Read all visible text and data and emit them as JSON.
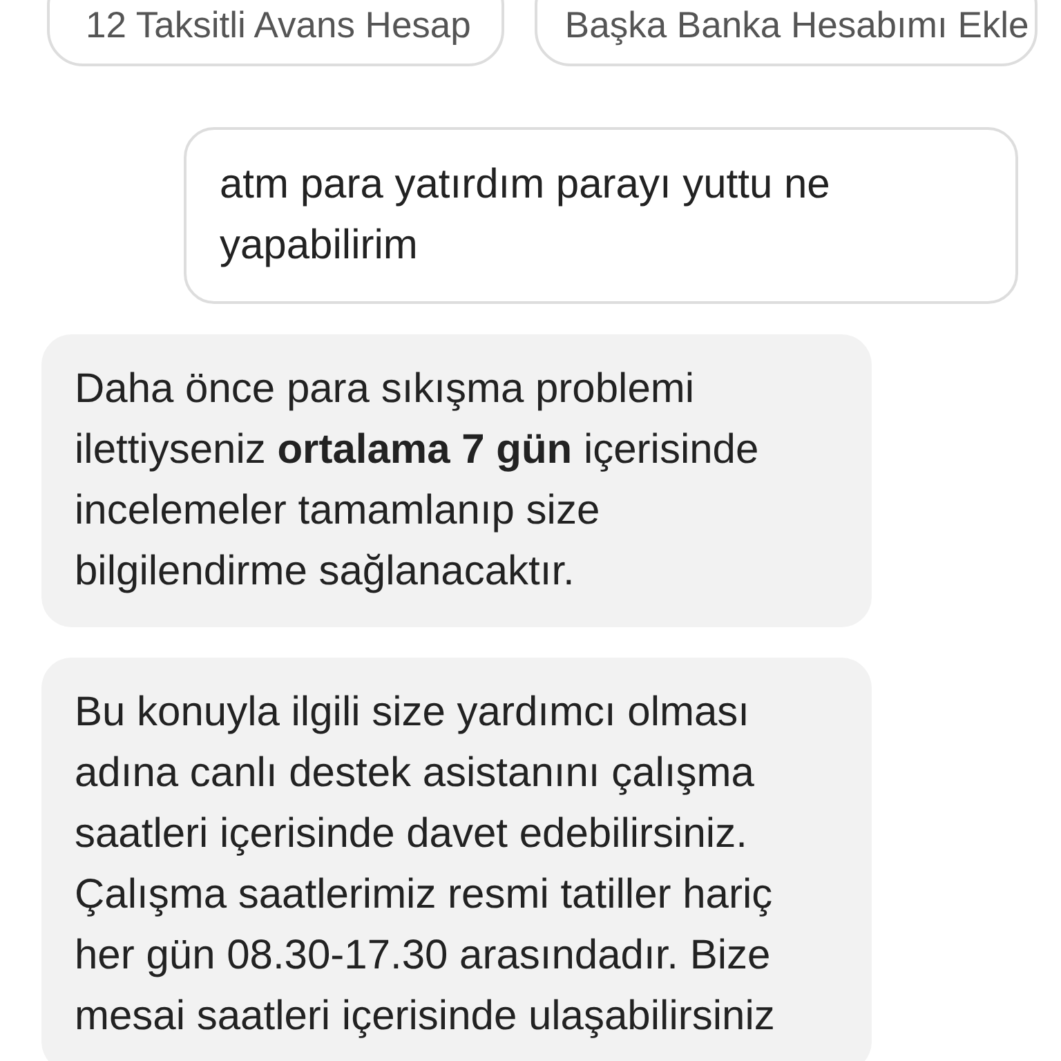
{
  "suggestions": [
    {
      "label": "12 Taksitli Avans Hesap"
    },
    {
      "label": "Başka Banka Hesabımı Ekle"
    }
  ],
  "messages": [
    {
      "kind": "user",
      "text": "atm para yatırdım parayı yuttu ne yapabilirim"
    },
    {
      "kind": "bot",
      "text": "Daha önce para sıkışma problemi ilettiyseniz **ortalama 7 gün** içerisinde incelemeler tamamlanıp size bilgilendirme sağlanacaktır."
    },
    {
      "kind": "bot",
      "text": "Bu konuyla ilgili size yardımcı olması adına canlı destek asistanını çalışma saatleri içerisinde davet edebilirsiniz. Çalışma saatlerimiz resmi tatiller hariç her gün 08.30-17.30 arasındadır. Bize mesai saatleri içerisinde ulaşabilirsiniz"
    }
  ]
}
